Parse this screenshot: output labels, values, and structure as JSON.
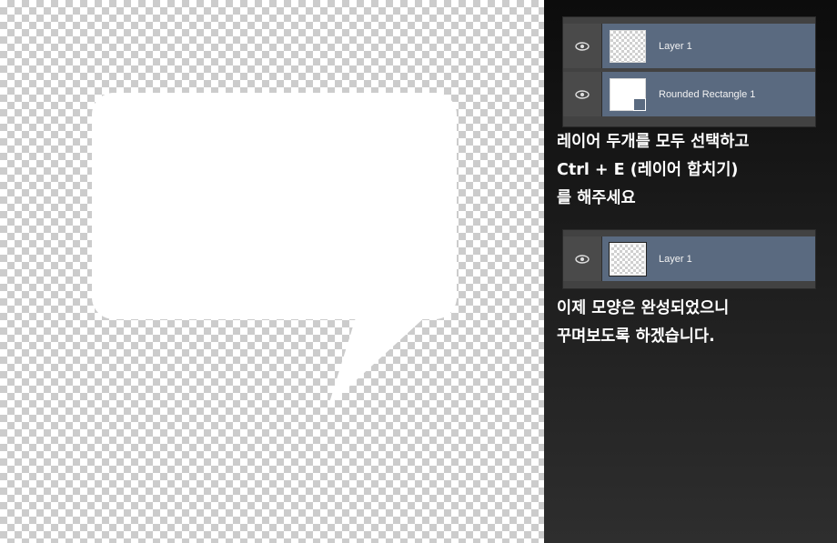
{
  "layers_panel_before": {
    "rows": [
      {
        "name": "Layer 1",
        "thumbnail": "transparent"
      },
      {
        "name": "Rounded Rectangle 1",
        "thumbnail": "shape"
      }
    ]
  },
  "instruction_1": "레이어 두개를 모두 선택하고\nCtrl + E (레이어 합치기)\n를 해주세요",
  "layers_panel_after": {
    "rows": [
      {
        "name": "Layer 1",
        "thumbnail": "merged"
      }
    ]
  },
  "instruction_2": "이제 모양은 완성되었으니\n꾸며보도록 하겠습니다.",
  "icons": {
    "visibility": "eye-icon"
  },
  "colors": {
    "panel_bg": "#1e1e1e",
    "layer_selected": "#5a6a80",
    "bubble": "#ffffff"
  }
}
